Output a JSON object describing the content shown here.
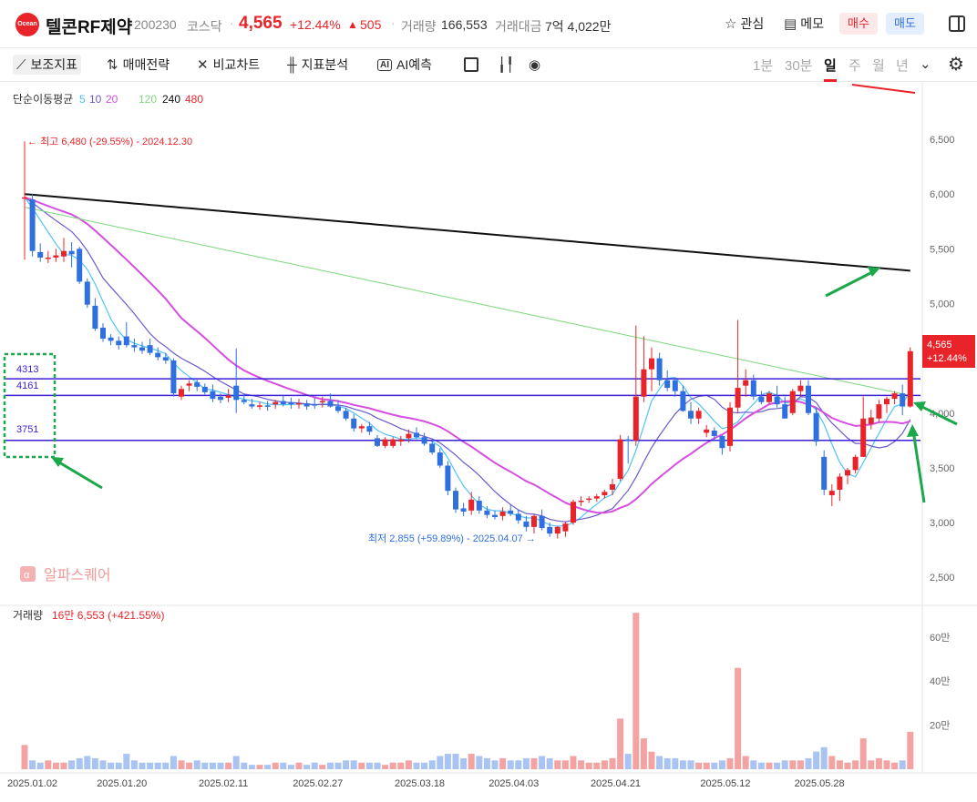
{
  "header": {
    "logo_text": "Ocean",
    "stock_name": "텔콘RF제약",
    "code": "200230",
    "market": "코스닥",
    "price": "4,565",
    "change_rate": "+12.44%",
    "change_arrow": "▲",
    "change_abs": "505",
    "volume_label": "거래량",
    "volume_value": "166,553",
    "amount_label": "거래대금",
    "amount_value": "7억 4,022만",
    "watch_label": "관심",
    "memo_label": "메모",
    "buy_label": "매수",
    "sell_label": "매도"
  },
  "toolbar": {
    "indicators": "보조지표",
    "strategy": "매매전략",
    "compare": "비교차트",
    "analysis": "지표분석",
    "ai": "AI예측",
    "periods": [
      "1분",
      "30분",
      "일",
      "주",
      "월",
      "년"
    ],
    "selected_period": "일"
  },
  "colors": {
    "up": "#e8242a",
    "down": "#2f6fe0",
    "ma5": "#4fc3f7",
    "ma10": "#6a5acd",
    "ma20": "#d64ee0",
    "ma120": "#7ed77e",
    "ma240": "#111111",
    "ma480": "#e8242a",
    "hline": "#3b1fd6",
    "annotation_green": "#1aa84a"
  },
  "chart_data": {
    "type": "candlestick",
    "legend": {
      "title": "단순이동평균",
      "periods": [
        "5",
        "10",
        "20",
        "120",
        "240",
        "480"
      ]
    },
    "y_price_ticks": [
      "6,500",
      "6,000",
      "5,500",
      "5,000",
      "4,500",
      "4,000",
      "3,500",
      "3,000",
      "2,500"
    ],
    "y_price_range": [
      2500,
      6500
    ],
    "x_dates": [
      "2025.01.02",
      "2025.01.20",
      "2025.02.11",
      "2025.02.27",
      "2025.03.18",
      "2025.04.03",
      "2025.04.21",
      "2025.05.12",
      "2025.05.28"
    ],
    "high_label": "최고 6,480 (-29.55%) - 2024.12.30",
    "low_label": "최저 2,855 (+59.89%) - 2025.04.07",
    "current_price": "4,565",
    "current_change": "+12.44%",
    "horizontal_lines": [
      4313,
      4161,
      3751
    ],
    "horizontal_line_labels": [
      "4313",
      "4161",
      "3751"
    ],
    "watermark": "알파스퀘어",
    "volume_label": "거래량",
    "volume_value": "16만 6,553 (+421.55%)",
    "y_volume_ticks": [
      "60만",
      "40만",
      "20만"
    ],
    "candles": [
      [
        5970,
        6480,
        5400,
        5970
      ],
      [
        5950,
        6000,
        5430,
        5480
      ],
      [
        5470,
        5550,
        5380,
        5420
      ],
      [
        5420,
        5480,
        5370,
        5420
      ],
      [
        5420,
        5500,
        5380,
        5440
      ],
      [
        5430,
        5600,
        5380,
        5480
      ],
      [
        5480,
        5560,
        5330,
        5450
      ],
      [
        5500,
        5520,
        5180,
        5200
      ],
      [
        5200,
        5230,
        4960,
        4990
      ],
      [
        4980,
        5050,
        4750,
        4770
      ],
      [
        4780,
        4820,
        4650,
        4680
      ],
      [
        4690,
        4720,
        4620,
        4660
      ],
      [
        4660,
        4700,
        4580,
        4620
      ],
      [
        4700,
        4830,
        4600,
        4620
      ],
      [
        4620,
        4680,
        4560,
        4600
      ],
      [
        4600,
        4650,
        4540,
        4570
      ],
      [
        4620,
        4680,
        4530,
        4550
      ],
      [
        4550,
        4600,
        4480,
        4510
      ],
      [
        4510,
        4550,
        4450,
        4480
      ],
      [
        4480,
        4500,
        4150,
        4180
      ],
      [
        4150,
        4250,
        4120,
        4220
      ],
      [
        4250,
        4300,
        4200,
        4270
      ],
      [
        4280,
        4320,
        4200,
        4240
      ],
      [
        4240,
        4270,
        4170,
        4190
      ],
      [
        4200,
        4260,
        4100,
        4130
      ],
      [
        4150,
        4180,
        4090,
        4120
      ],
      [
        4140,
        4220,
        4100,
        4160
      ],
      [
        4250,
        4590,
        4000,
        4120
      ],
      [
        4120,
        4170,
        4080,
        4100
      ],
      [
        4080,
        4130,
        4040,
        4060
      ],
      [
        4060,
        4100,
        4030,
        4070
      ],
      [
        4070,
        4110,
        4020,
        4060
      ],
      [
        4080,
        4120,
        4040,
        4100
      ],
      [
        4110,
        4160,
        4060,
        4080
      ],
      [
        4100,
        4140,
        4040,
        4080
      ],
      [
        4080,
        4130,
        4040,
        4090
      ],
      [
        4090,
        4120,
        4030,
        4060
      ],
      [
        4080,
        4140,
        4040,
        4070
      ],
      [
        4100,
        4150,
        4050,
        4110
      ],
      [
        4110,
        4180,
        4050,
        4060
      ],
      [
        4060,
        4120,
        4000,
        4020
      ],
      [
        4020,
        4050,
        3930,
        3950
      ],
      [
        3950,
        3990,
        3830,
        3860
      ],
      [
        3860,
        3900,
        3820,
        3880
      ],
      [
        3880,
        3920,
        3800,
        3830
      ],
      [
        3770,
        3800,
        3690,
        3700
      ],
      [
        3700,
        3780,
        3680,
        3760
      ],
      [
        3700,
        3780,
        3680,
        3760
      ],
      [
        3740,
        3790,
        3700,
        3760
      ],
      [
        3770,
        3850,
        3730,
        3810
      ],
      [
        3820,
        3870,
        3760,
        3780
      ],
      [
        3780,
        3820,
        3700,
        3720
      ],
      [
        3720,
        3760,
        3620,
        3640
      ],
      [
        3640,
        3680,
        3500,
        3520
      ],
      [
        3520,
        3560,
        3250,
        3290
      ],
      [
        3290,
        3320,
        3090,
        3120
      ],
      [
        3130,
        3180,
        3060,
        3100
      ],
      [
        3110,
        3280,
        3070,
        3210
      ],
      [
        3200,
        3240,
        3080,
        3110
      ],
      [
        3110,
        3150,
        3040,
        3070
      ],
      [
        3070,
        3110,
        3030,
        3050
      ],
      [
        3060,
        3140,
        3020,
        3100
      ],
      [
        3110,
        3160,
        3060,
        3080
      ],
      [
        3080,
        3120,
        2990,
        3020
      ],
      [
        3010,
        3060,
        2920,
        2960
      ],
      [
        2960,
        3080,
        2900,
        3060
      ],
      [
        3060,
        3120,
        2930,
        2950
      ],
      [
        2960,
        3000,
        2870,
        2900
      ],
      [
        2900,
        2970,
        2855,
        2960
      ],
      [
        2920,
        3010,
        2870,
        2990
      ],
      [
        3000,
        3210,
        2980,
        3190
      ],
      [
        3190,
        3240,
        3150,
        3200
      ],
      [
        3210,
        3240,
        3180,
        3220
      ],
      [
        3220,
        3260,
        3190,
        3240
      ],
      [
        3250,
        3300,
        3220,
        3280
      ],
      [
        3300,
        3400,
        3250,
        3350
      ],
      [
        3400,
        3800,
        3380,
        3760
      ],
      [
        3760,
        3790,
        3540,
        3750
      ],
      [
        3750,
        4800,
        3700,
        4150
      ],
      [
        4150,
        4700,
        4100,
        4400
      ],
      [
        4400,
        4600,
        4200,
        4500
      ],
      [
        4500,
        4550,
        4250,
        4300
      ],
      [
        4300,
        4390,
        4200,
        4230
      ],
      [
        4300,
        4320,
        4150,
        4200
      ],
      [
        4200,
        4250,
        4010,
        4020
      ],
      [
        4020,
        4100,
        3900,
        3950
      ],
      [
        3950,
        4050,
        3900,
        4020
      ],
      [
        3820,
        3890,
        3780,
        3850
      ],
      [
        3840,
        3870,
        3750,
        3790
      ],
      [
        3790,
        3800,
        3620,
        3680
      ],
      [
        3700,
        4100,
        3650,
        4050
      ],
      [
        4050,
        4850,
        4000,
        4230
      ],
      [
        4250,
        4400,
        4150,
        4300
      ],
      [
        4300,
        4350,
        4120,
        4150
      ],
      [
        4150,
        4200,
        4080,
        4100
      ],
      [
        4100,
        4200,
        4080,
        4180
      ],
      [
        4150,
        4250,
        4050,
        4080
      ],
      [
        4080,
        4150,
        4020,
        3950
      ],
      [
        4000,
        4220,
        3980,
        4200
      ],
      [
        4200,
        4300,
        4150,
        4250
      ],
      [
        4250,
        4300,
        3980,
        4000
      ],
      [
        4000,
        4050,
        3700,
        3740
      ],
      [
        3600,
        3660,
        3250,
        3300
      ],
      [
        3250,
        3350,
        3150,
        3290
      ],
      [
        3300,
        3450,
        3200,
        3420
      ],
      [
        3430,
        3500,
        3350,
        3480
      ],
      [
        3480,
        3620,
        3450,
        3600
      ],
      [
        3600,
        4150,
        3600,
        3950
      ],
      [
        3900,
        4030,
        3850,
        3960
      ],
      [
        3950,
        4120,
        3920,
        4080
      ],
      [
        4080,
        4150,
        4000,
        4130
      ],
      [
        4130,
        4200,
        4080,
        4180
      ],
      [
        4180,
        4260,
        3980,
        4060
      ],
      [
        4060,
        4600,
        4050,
        4565
      ]
    ],
    "volumes": [
      11,
      4,
      3,
      4,
      3,
      3,
      4,
      5,
      6,
      5,
      4,
      3,
      3,
      7,
      4,
      3,
      3,
      3,
      3,
      6,
      4,
      3,
      4,
      3,
      3,
      3,
      3,
      6,
      3,
      2,
      2,
      2,
      3,
      3,
      2,
      3,
      2,
      3,
      2,
      3,
      3,
      4,
      4,
      3,
      3,
      3,
      2,
      3,
      3,
      4,
      3,
      3,
      4,
      6,
      7,
      7,
      5,
      7,
      6,
      5,
      4,
      5,
      4,
      4,
      5,
      5,
      6,
      5,
      4,
      4,
      6,
      4,
      3,
      3,
      4,
      5,
      23,
      7,
      71,
      14,
      8,
      6,
      5,
      5,
      4,
      4,
      3,
      3,
      3,
      4,
      5,
      46,
      6,
      4,
      3,
      3,
      3,
      4,
      4,
      4,
      5,
      8,
      10,
      6,
      4,
      3,
      4,
      14,
      4,
      5,
      4,
      3,
      4,
      17
    ]
  }
}
